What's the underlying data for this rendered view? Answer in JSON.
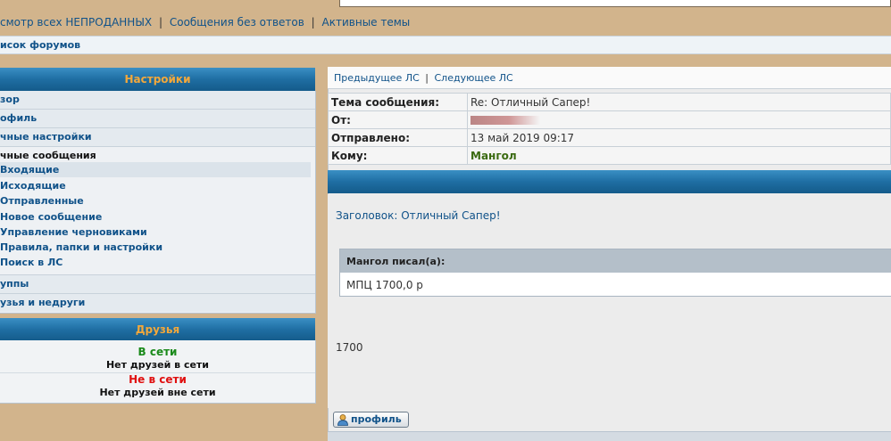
{
  "topnav": {
    "unsold": "смотр всех НЕПРОДАННЫХ",
    "no_replies": "Сообщения без ответов",
    "active": "Активные темы",
    "sep": "|"
  },
  "breadcrumb": "исок форумов",
  "settings": {
    "title": "Настройки",
    "items": [
      "зор",
      "офиль",
      "чные настройки",
      "чные сообщения"
    ],
    "sub": [
      "Входящие",
      "Исходящие",
      "Отправленные",
      "Новое сообщение",
      "Управление черновиками",
      "Правила, папки и настройки",
      "Поиск в ЛС"
    ],
    "bottom": [
      "уппы",
      "узья и недруги"
    ]
  },
  "friends": {
    "title": "Друзья",
    "online": "В сети",
    "online_none": "Нет друзей в сети",
    "offline": "Не в сети",
    "offline_none": "Нет друзей вне сети"
  },
  "pm_nav": {
    "prev": "Предыдущее ЛС",
    "next": "Следующее ЛС",
    "sep": "|"
  },
  "header": {
    "subject_label": "Тема сообщения:",
    "subject_value": "Re: Отличный Сапер!",
    "from_label": "От:",
    "sent_label": "Отправлено:",
    "sent_value": "13 май 2019 09:17",
    "to_label": "Кому:",
    "to_value": "Мангол"
  },
  "message": {
    "subject_line": "Заголовок: Отличный Сапер!",
    "quote_author": "Мангол писал(а):",
    "quote_text": "МПЦ 1700,0 р",
    "body": "1700"
  },
  "profile_button": "профиль",
  "colors": {
    "background": "#d2b48c",
    "accent_orange": "#f3a83b",
    "link": "#105289",
    "online": "#1a8a1a",
    "offline": "#e01010",
    "recipient": "#3a6a10"
  }
}
